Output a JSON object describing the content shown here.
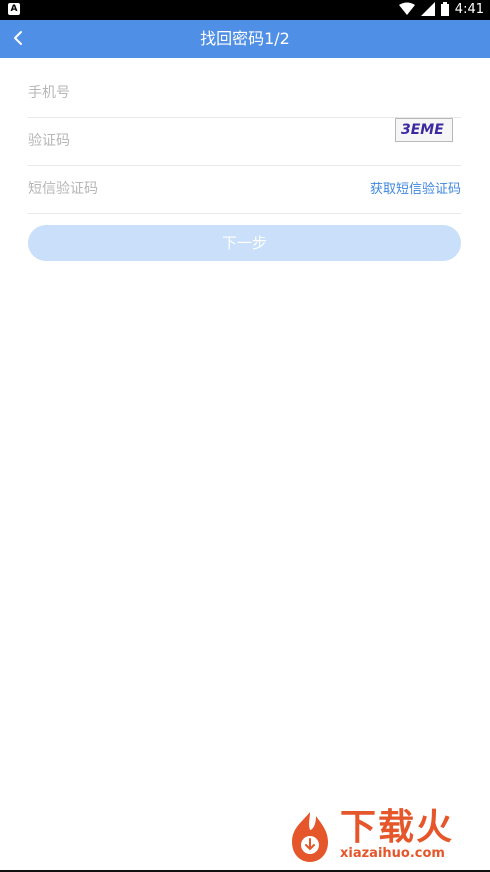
{
  "status_bar": {
    "time": "4:41",
    "left_icon": "A"
  },
  "header": {
    "title": "找回密码1/2",
    "back_icon": "chevron-left-icon"
  },
  "form": {
    "fields": [
      {
        "label": "手机号"
      },
      {
        "label": "验证码",
        "captcha_text": "3EME"
      },
      {
        "label": "短信验证码",
        "action": "获取短信验证码"
      }
    ],
    "next_button": "下一步"
  },
  "watermark": {
    "title": "下载火",
    "url": "xiazaihuo.com"
  },
  "colors": {
    "header": "#4f8fe6",
    "button_disabled": "#c9dffa",
    "link": "#3f86df",
    "placeholder": "#b6b6b6",
    "watermark": "#e5562b"
  }
}
